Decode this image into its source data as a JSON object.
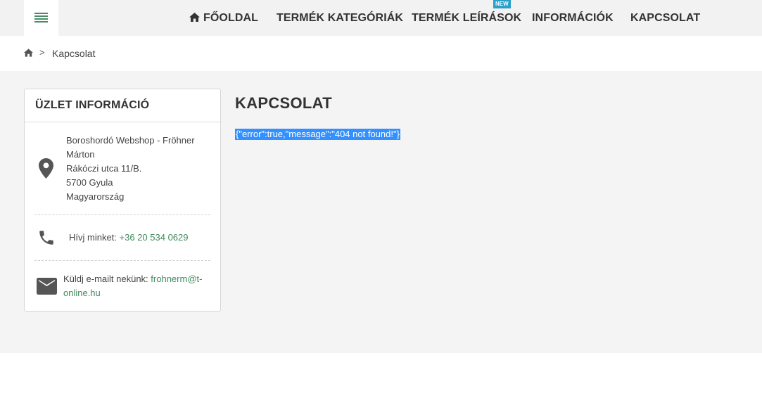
{
  "header": {
    "nav": [
      {
        "label": "FŐOLDAL",
        "icon": "home-icon"
      },
      {
        "label": "TERMÉK KATEGÓRIÁK"
      },
      {
        "label": "TERMÉK LEÍRÁSOK",
        "badge": "NEW"
      },
      {
        "label": "INFORMÁCIÓK"
      },
      {
        "label": "KAPCSOLAT"
      }
    ]
  },
  "breadcrumb": {
    "home_icon": "home-icon",
    "separator": ">",
    "current": "Kapcsolat"
  },
  "store_info": {
    "title": "ÜZLET INFORMÁCIÓ",
    "address_lines": [
      "Boroshordó Webshop - Fröhner",
      "Márton",
      "Rákóczi utca 11/B.",
      "5700 Gyula",
      "Magyarország"
    ],
    "phone_label": "Hívj minket:",
    "phone": "+36 20 534 0629",
    "email_label": "Küldj e-mailt nekünk:",
    "email_part1": "frohnerm@t-",
    "email_part2": "online.hu"
  },
  "content": {
    "title": "KAPCSOLAT",
    "error_message": "{\"error\":true,\"message\":\"404 not found!\"}"
  },
  "colors": {
    "accent": "#3f8a5c",
    "badge": "#2aa0c8",
    "selection": "#3390ff"
  }
}
